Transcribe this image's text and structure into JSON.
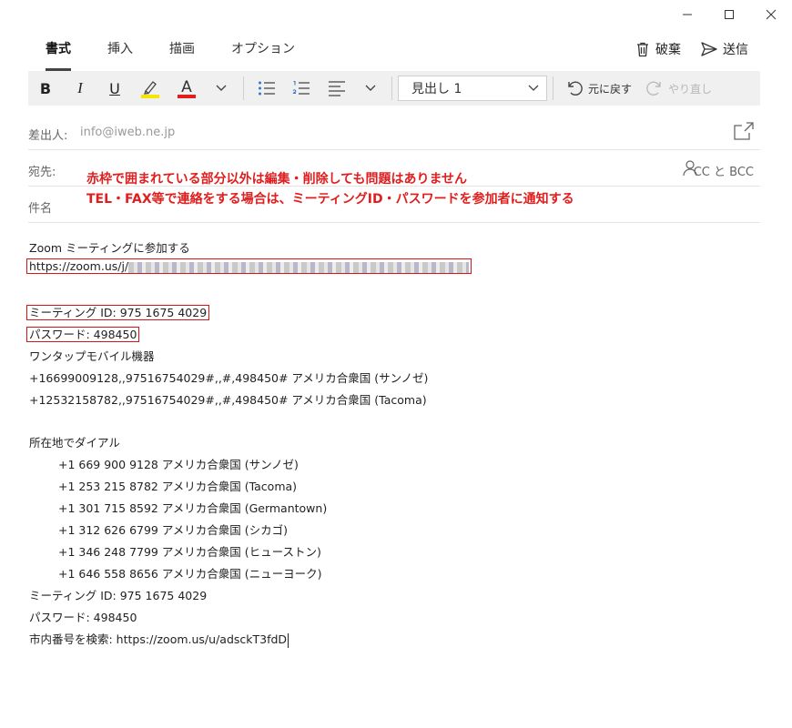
{
  "tabs": [
    "書式",
    "挿入",
    "描画",
    "オプション"
  ],
  "actions": {
    "discard_label": "破棄",
    "send_label": "送信"
  },
  "toolbar": {
    "bold": "B",
    "italic": "I",
    "underline": "U",
    "font_color_letter": "A",
    "style_value": "見出し 1",
    "undo_label": "元に戻す",
    "redo_label": "やり直し"
  },
  "fields": {
    "from_label": "差出人:",
    "from_value": "info@iweb.ne.jp",
    "to_label": "宛先:",
    "cc_bcc_label": "CC と BCC",
    "subject_label": "件名"
  },
  "notes": [
    "赤枠で囲まれている部分以外は編集・削除しても問題はありません",
    "TEL・FAX等で連絡をする場合は、ミーティングID・パスワードを参加者に通知する"
  ],
  "body": {
    "intro": "Zoom ミーティングに参加する",
    "join_url_prefix": "https://zoom.us/j/",
    "meeting_id_line": "ミーティング ID: 975 1675 4029",
    "password_line": "パスワード: 498450",
    "one_tap_heading": "ワンタップモバイル機器",
    "one_tap": [
      "+16699009128,,97516754029#,,#,498450# アメリカ合衆国 (サンノゼ)",
      "+12532158782,,97516754029#,,#,498450# アメリカ合衆国 (Tacoma)"
    ],
    "dial_heading": "所在地でダイアル",
    "dial": [
      "+1 669 900 9128 アメリカ合衆国 (サンノゼ)",
      "+1 253 215 8782 アメリカ合衆国 (Tacoma)",
      "+1 301 715 8592 アメリカ合衆国 (Germantown)",
      "+1 312 626 6799 アメリカ合衆国 (シカゴ)",
      "+1 346 248 7799 アメリカ合衆国 (ヒューストン)",
      "+1 646 558 8656 アメリカ合衆国 (ニューヨーク)"
    ],
    "meeting_id_line2": "ミーティング ID: 975 1675 4029",
    "password_line2": "パスワード: 498450",
    "local_number": "市内番号を検索: https://zoom.us/u/adsckT3fdD"
  },
  "colors": {
    "highlight": "#f5e600",
    "font_color": "#e01e1e",
    "note": "#e01e1e",
    "box": "#d81414"
  }
}
